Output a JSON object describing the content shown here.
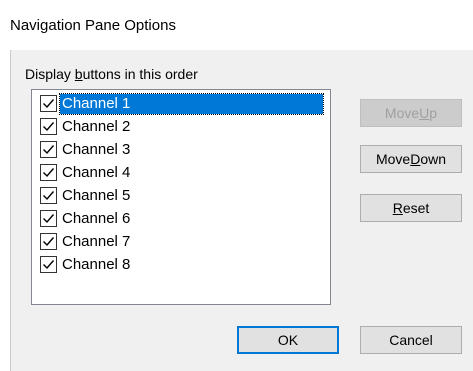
{
  "dialog": {
    "title": "Navigation Pane Options"
  },
  "list": {
    "label_prefix": "Display ",
    "label_accel": "b",
    "label_suffix": "uttons in this order",
    "items": [
      {
        "label": "Channel 1",
        "checked": true,
        "selected": true
      },
      {
        "label": "Channel 2",
        "checked": true,
        "selected": false
      },
      {
        "label": "Channel 3",
        "checked": true,
        "selected": false
      },
      {
        "label": "Channel 4",
        "checked": true,
        "selected": false
      },
      {
        "label": "Channel 5",
        "checked": true,
        "selected": false
      },
      {
        "label": "Channel 6",
        "checked": true,
        "selected": false
      },
      {
        "label": "Channel 7",
        "checked": true,
        "selected": false
      },
      {
        "label": "Channel 8",
        "checked": true,
        "selected": false
      }
    ]
  },
  "buttons": {
    "move_up": {
      "prefix": "Move ",
      "accel": "U",
      "suffix": "p",
      "enabled": false
    },
    "move_down": {
      "prefix": "Move ",
      "accel": "D",
      "suffix": "own",
      "enabled": true
    },
    "reset": {
      "prefix": "",
      "accel": "R",
      "suffix": "eset",
      "enabled": true
    },
    "ok": {
      "label": "OK"
    },
    "cancel": {
      "label": "Cancel"
    }
  },
  "colors": {
    "selection": "#0078d7",
    "dialog_background": "#f0f0f0",
    "disabled_text": "#a0a0a0"
  }
}
